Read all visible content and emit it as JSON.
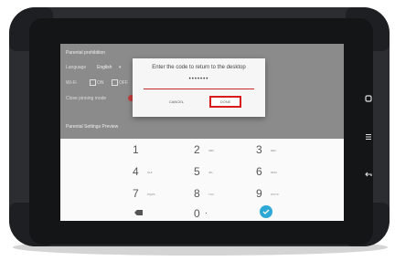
{
  "settings": {
    "title": "Parental prohibition",
    "language_label": "Language",
    "language_value": "English",
    "wifi_label": "Wi-Fi",
    "option_1": "ON",
    "option_2": "OFF",
    "pin_label": "Close pinning mode",
    "section_title": "Parental Settings Preview"
  },
  "dialog": {
    "title": "Enter the code to return to the desktop",
    "code_value": "•••••••",
    "cancel_label": "CANCEL",
    "done_label": "DONE"
  },
  "keypad": {
    "keys": [
      {
        "digit": "1",
        "letters": ""
      },
      {
        "digit": "2",
        "letters": "ABC"
      },
      {
        "digit": "3",
        "letters": "DEF"
      },
      {
        "digit": "4",
        "letters": "GHI"
      },
      {
        "digit": "5",
        "letters": "JKL"
      },
      {
        "digit": "6",
        "letters": "MNO"
      },
      {
        "digit": "7",
        "letters": "PQRS"
      },
      {
        "digit": "8",
        "letters": "TUV"
      },
      {
        "digit": "9",
        "letters": "WXYZ"
      },
      {
        "digit": "0",
        "letters": ""
      }
    ],
    "dot_label": ".",
    "backspace_icon": "backspace-icon",
    "confirm_icon": "check-icon"
  },
  "nav": {
    "home_icon": "home-icon",
    "menu_icon": "menu-icon",
    "back_icon": "back-icon"
  },
  "colors": {
    "accent_red": "#d81b1b",
    "confirm_blue": "#2ea8d6",
    "overlay_gray": "#8b8b8b"
  }
}
